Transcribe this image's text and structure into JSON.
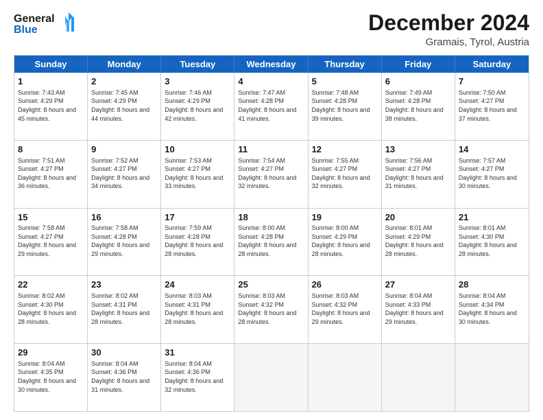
{
  "header": {
    "logo_line1": "General",
    "logo_line2": "Blue",
    "month": "December 2024",
    "location": "Gramais, Tyrol, Austria"
  },
  "weekdays": [
    "Sunday",
    "Monday",
    "Tuesday",
    "Wednesday",
    "Thursday",
    "Friday",
    "Saturday"
  ],
  "weeks": [
    [
      {
        "day": "1",
        "sunrise": "Sunrise: 7:43 AM",
        "sunset": "Sunset: 4:29 PM",
        "daylight": "Daylight: 8 hours and 45 minutes."
      },
      {
        "day": "2",
        "sunrise": "Sunrise: 7:45 AM",
        "sunset": "Sunset: 4:29 PM",
        "daylight": "Daylight: 8 hours and 44 minutes."
      },
      {
        "day": "3",
        "sunrise": "Sunrise: 7:46 AM",
        "sunset": "Sunset: 4:29 PM",
        "daylight": "Daylight: 8 hours and 42 minutes."
      },
      {
        "day": "4",
        "sunrise": "Sunrise: 7:47 AM",
        "sunset": "Sunset: 4:28 PM",
        "daylight": "Daylight: 8 hours and 41 minutes."
      },
      {
        "day": "5",
        "sunrise": "Sunrise: 7:48 AM",
        "sunset": "Sunset: 4:28 PM",
        "daylight": "Daylight: 8 hours and 39 minutes."
      },
      {
        "day": "6",
        "sunrise": "Sunrise: 7:49 AM",
        "sunset": "Sunset: 4:28 PM",
        "daylight": "Daylight: 8 hours and 38 minutes."
      },
      {
        "day": "7",
        "sunrise": "Sunrise: 7:50 AM",
        "sunset": "Sunset: 4:27 PM",
        "daylight": "Daylight: 8 hours and 37 minutes."
      }
    ],
    [
      {
        "day": "8",
        "sunrise": "Sunrise: 7:51 AM",
        "sunset": "Sunset: 4:27 PM",
        "daylight": "Daylight: 8 hours and 36 minutes."
      },
      {
        "day": "9",
        "sunrise": "Sunrise: 7:52 AM",
        "sunset": "Sunset: 4:27 PM",
        "daylight": "Daylight: 8 hours and 34 minutes."
      },
      {
        "day": "10",
        "sunrise": "Sunrise: 7:53 AM",
        "sunset": "Sunset: 4:27 PM",
        "daylight": "Daylight: 8 hours and 33 minutes."
      },
      {
        "day": "11",
        "sunrise": "Sunrise: 7:54 AM",
        "sunset": "Sunset: 4:27 PM",
        "daylight": "Daylight: 8 hours and 32 minutes."
      },
      {
        "day": "12",
        "sunrise": "Sunrise: 7:55 AM",
        "sunset": "Sunset: 4:27 PM",
        "daylight": "Daylight: 8 hours and 32 minutes."
      },
      {
        "day": "13",
        "sunrise": "Sunrise: 7:56 AM",
        "sunset": "Sunset: 4:27 PM",
        "daylight": "Daylight: 8 hours and 31 minutes."
      },
      {
        "day": "14",
        "sunrise": "Sunrise: 7:57 AM",
        "sunset": "Sunset: 4:27 PM",
        "daylight": "Daylight: 8 hours and 30 minutes."
      }
    ],
    [
      {
        "day": "15",
        "sunrise": "Sunrise: 7:58 AM",
        "sunset": "Sunset: 4:27 PM",
        "daylight": "Daylight: 8 hours and 29 minutes."
      },
      {
        "day": "16",
        "sunrise": "Sunrise: 7:58 AM",
        "sunset": "Sunset: 4:28 PM",
        "daylight": "Daylight: 8 hours and 29 minutes."
      },
      {
        "day": "17",
        "sunrise": "Sunrise: 7:59 AM",
        "sunset": "Sunset: 4:28 PM",
        "daylight": "Daylight: 8 hours and 28 minutes."
      },
      {
        "day": "18",
        "sunrise": "Sunrise: 8:00 AM",
        "sunset": "Sunset: 4:28 PM",
        "daylight": "Daylight: 8 hours and 28 minutes."
      },
      {
        "day": "19",
        "sunrise": "Sunrise: 8:00 AM",
        "sunset": "Sunset: 4:29 PM",
        "daylight": "Daylight: 8 hours and 28 minutes."
      },
      {
        "day": "20",
        "sunrise": "Sunrise: 8:01 AM",
        "sunset": "Sunset: 4:29 PM",
        "daylight": "Daylight: 8 hours and 28 minutes."
      },
      {
        "day": "21",
        "sunrise": "Sunrise: 8:01 AM",
        "sunset": "Sunset: 4:30 PM",
        "daylight": "Daylight: 8 hours and 28 minutes."
      }
    ],
    [
      {
        "day": "22",
        "sunrise": "Sunrise: 8:02 AM",
        "sunset": "Sunset: 4:30 PM",
        "daylight": "Daylight: 8 hours and 28 minutes."
      },
      {
        "day": "23",
        "sunrise": "Sunrise: 8:02 AM",
        "sunset": "Sunset: 4:31 PM",
        "daylight": "Daylight: 8 hours and 28 minutes."
      },
      {
        "day": "24",
        "sunrise": "Sunrise: 8:03 AM",
        "sunset": "Sunset: 4:31 PM",
        "daylight": "Daylight: 8 hours and 28 minutes."
      },
      {
        "day": "25",
        "sunrise": "Sunrise: 8:03 AM",
        "sunset": "Sunset: 4:32 PM",
        "daylight": "Daylight: 8 hours and 28 minutes."
      },
      {
        "day": "26",
        "sunrise": "Sunrise: 8:03 AM",
        "sunset": "Sunset: 4:32 PM",
        "daylight": "Daylight: 8 hours and 29 minutes."
      },
      {
        "day": "27",
        "sunrise": "Sunrise: 8:04 AM",
        "sunset": "Sunset: 4:33 PM",
        "daylight": "Daylight: 8 hours and 29 minutes."
      },
      {
        "day": "28",
        "sunrise": "Sunrise: 8:04 AM",
        "sunset": "Sunset: 4:34 PM",
        "daylight": "Daylight: 8 hours and 30 minutes."
      }
    ],
    [
      {
        "day": "29",
        "sunrise": "Sunrise: 8:04 AM",
        "sunset": "Sunset: 4:35 PM",
        "daylight": "Daylight: 8 hours and 30 minutes."
      },
      {
        "day": "30",
        "sunrise": "Sunrise: 8:04 AM",
        "sunset": "Sunset: 4:36 PM",
        "daylight": "Daylight: 8 hours and 31 minutes."
      },
      {
        "day": "31",
        "sunrise": "Sunrise: 8:04 AM",
        "sunset": "Sunset: 4:36 PM",
        "daylight": "Daylight: 8 hours and 32 minutes."
      },
      null,
      null,
      null,
      null
    ]
  ]
}
